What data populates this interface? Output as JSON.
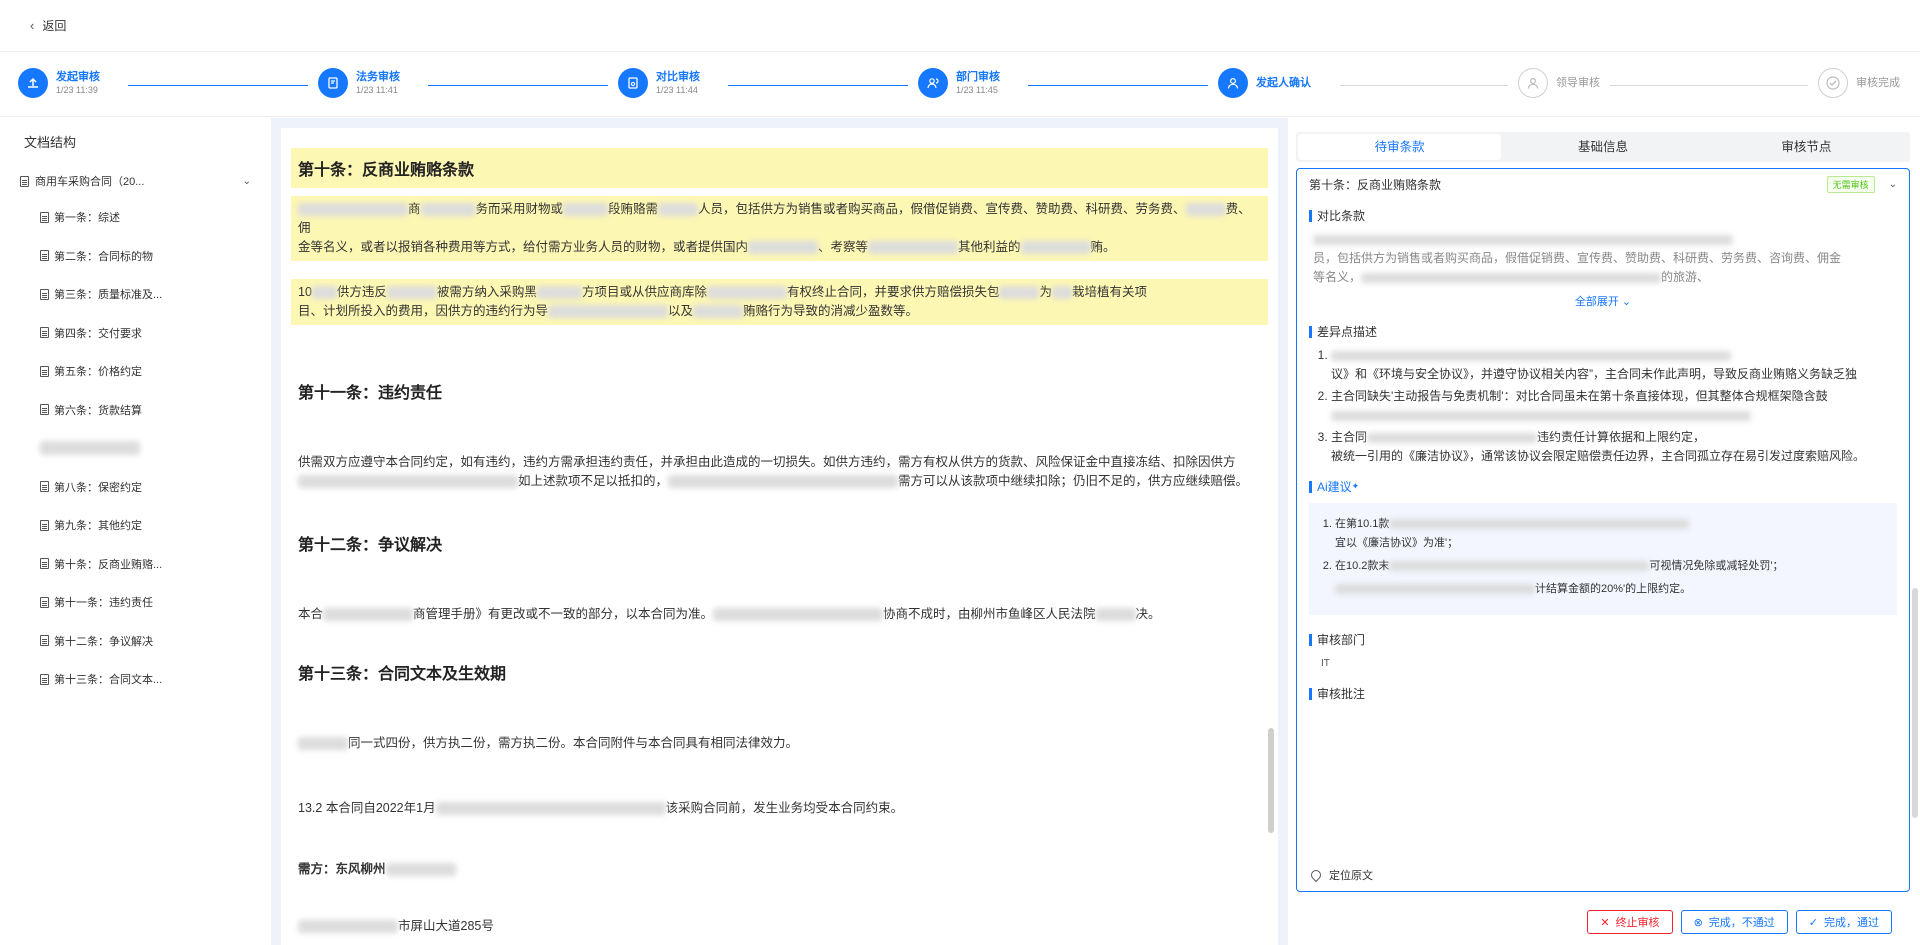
{
  "topbar": {
    "back_label": "返回"
  },
  "steps": [
    {
      "name": "发起审核",
      "time": "1/23 11:39",
      "state": "done"
    },
    {
      "name": "法务审核",
      "time": "1/23 11:41",
      "state": "done"
    },
    {
      "name": "对比审核",
      "time": "1/23 11:44",
      "state": "done"
    },
    {
      "name": "部门审核",
      "time": "1/23 11:45",
      "state": "done"
    },
    {
      "name": "发起人确认",
      "time": "",
      "state": "current"
    },
    {
      "name": "领导审核",
      "time": "",
      "state": "pending"
    },
    {
      "name": "审核完成",
      "time": "",
      "state": "pending"
    }
  ],
  "sidebar": {
    "title": "文档结构",
    "root": "商用车采购合同（20...",
    "items": [
      "第一条：综述",
      "第二条：合同标的物",
      "第三条：质量标准及...",
      "第四条：交付要求",
      "第五条：价格约定",
      "第六条：货款结算",
      "",
      "第八条：保密约定",
      "第九条：其他约定",
      "第十条：反商业贿赂...",
      "第十一条：违约责任",
      "第十二条：争议解决",
      "第十三条：合同文本..."
    ]
  },
  "document": {
    "s10_title": "第十条：反商业贿赂条款",
    "s10_p1a": "商",
    "s10_p1b": "务而采用财物或",
    "s10_p1c": "段贿赂需",
    "s10_p1d": "人员，包括供方为销售或者购买商品，假借促销费、宣传费、赞助费、科研费、劳务费、",
    "s10_p1e": "费、佣",
    "s10_p1f": "金等名义，或者以报销各种费用等方式，给付需方业务人员的财物，或者提供国内",
    "s10_p1g": "、考察等",
    "s10_p1h": "其他利益的",
    "s10_p1i": "贿。",
    "s10_p2a": "10",
    "s10_p2b": "供方违反",
    "s10_p2c": "被需方纳入采购黑",
    "s10_p2d": "方项目或从供应商库除",
    "s10_p2e": "有权终止合同，并要求供方赔偿损失包",
    "s10_p2f": "为",
    "s10_p2g": "栽培植有关项",
    "s10_p2h": "目、计划所投入的费用，因供方的违约行为导",
    "s10_p2i": "以及",
    "s10_p2j": "贿赂行为导致的消减少盈数等。",
    "s11_title": "第十一条：违约责任",
    "s11_p1": "供需双方应遵守本合同约定，如有违约，违约方需承担违约责任，并承担由此造成的一切损失。如供方违约，需方有权从供方的货款、风险保证金中直接冻结、扣除因供方",
    "s11_p2a": "如上述款项不足以抵扣的，",
    "s11_p2b": "需方可以从该款项中继续扣除；仍旧不足的，供方应继续赔偿。",
    "s12_title": "第十二条：争议解决",
    "s12_p1a": "本合",
    "s12_p1b": "商管理手册》有更改或不一致的部分，以本合同为准。",
    "s12_p1c": "协商不成时，由柳州市鱼峰区人民法院",
    "s12_p1d": "决。",
    "s13_title": "第十三条：合同文本及生效期",
    "s13_p1": "同一式四份，供方执二份，需方执二份。本合同附件与本合同具有相同法律效力。",
    "s13_p2a": "13.2",
    "s13_p2b": "本合同自2022年1月",
    "s13_p2c": "该采购合同前，发生业务均受本合同约束。",
    "buyer_label": "需方：东风柳州",
    "addr_tail": "号",
    "addr_mid": "市屏山大道285"
  },
  "right": {
    "tabs": [
      "待审条款",
      "基础信息",
      "审核节点"
    ],
    "clause_title": "第十条：反商业贿赂条款",
    "badge": "无需审核",
    "compare_title": "对比条款",
    "compare_l1": "员，包括供方为销售或者购买商品，假借促销费、宣传费、赞助费、科研费、劳务费、咨询费、佣金",
    "compare_l2": "等名义，",
    "compare_l2b": "的旅游、",
    "expand_label": "全部展开",
    "diff_title": "差异点描述",
    "diff_items": [
      "议》和《环境与安全协议》，并遵守协议相关内容”，主合同未作此声明，导致反商业贿赂义务缺乏独",
      "主合同缺失'主动报告与免责机制'：对比合同虽未在第十条直接体现，但其整体合规框架隐含鼓",
      "主合同",
      "违约责任计算依据和上限约定，",
      "被统一引用的《廉洁协议》，通常该协议会限定赔偿责任边界，主合同孤立存在易引发过度索赔风险。"
    ],
    "ai_title": "Ai建议",
    "ai_items": [
      "在第10.1款",
      "宜以《廉洁协议》为准'；",
      "在10.2款末",
      "可视情况免除或减轻处罚'；",
      "计结算金额的20%'的上限约定。"
    ],
    "dept_title": "审核部门",
    "dept_value": "IT",
    "comment_title": "审核批注",
    "locate_label": "定位原文",
    "btn_stop": "终止审核",
    "btn_reject": "完成，不通过",
    "btn_pass": "完成，通过"
  },
  "colors": {
    "accent": "#1677ff",
    "highlight": "#fdf7b4",
    "danger": "#f5222d",
    "ok": "#52c41a"
  }
}
